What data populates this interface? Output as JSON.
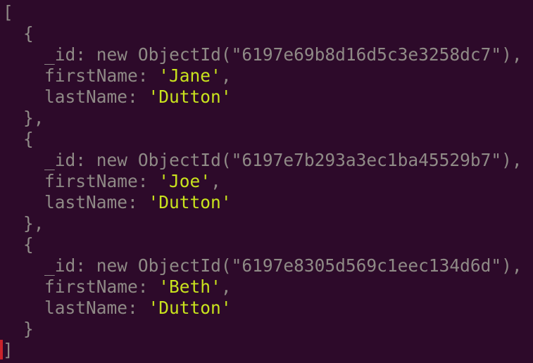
{
  "terminal": {
    "open_bracket": "[",
    "close_bracket": "]",
    "open_brace": "{",
    "close_brace_comma": "},",
    "close_brace": "}",
    "keyword_new": "new",
    "ctor_name": "ObjectId",
    "field_id": "_id",
    "field_first": "firstName",
    "field_last": "lastName"
  },
  "documents": [
    {
      "id": "6197e69b8d16d5c3e3258dc7",
      "firstName": "Jane",
      "lastName": "Dutton"
    },
    {
      "id": "6197e7b293a3ec1ba45529b7",
      "firstName": "Joe",
      "lastName": "Dutton"
    },
    {
      "id": "6197e8305d569c1eec134d6d",
      "firstName": "Beth",
      "lastName": "Dutton"
    }
  ],
  "colors": {
    "background": "#2d0a2a",
    "punctuation": "#8f8a86",
    "string": "#c9e31d",
    "cursor": "#c9232b"
  }
}
